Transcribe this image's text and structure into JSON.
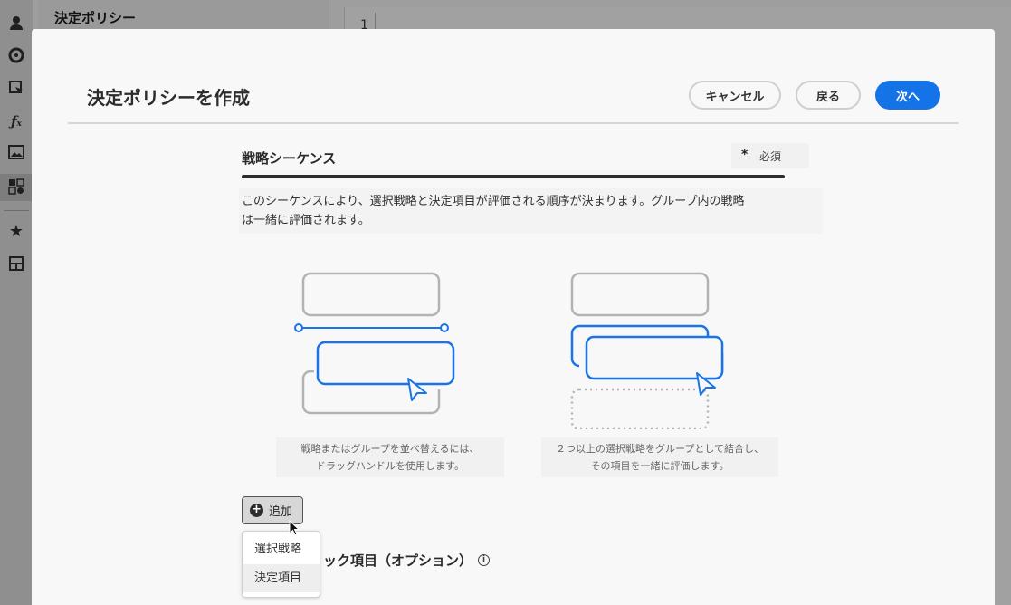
{
  "background": {
    "left_panel_title": "決定ポリシー",
    "editor_line_number": "1",
    "rail_icons": [
      "user-icon",
      "pie-chart-icon",
      "cursor-select-icon",
      "function-icon",
      "image-icon",
      "decision-icon",
      "star-icon",
      "grid-icon"
    ]
  },
  "modal": {
    "title": "決定ポリシーを作成",
    "buttons": {
      "cancel": "キャンセル",
      "back": "戻る",
      "next": "次へ"
    },
    "section": {
      "title": "戦略シーケンス",
      "required_mark": "*",
      "required_label": "必須",
      "description_line1": "このシーケンスにより、選択戦略と決定項目が評価される順序が決まります。グループ内の戦略",
      "description_line2": "は一緒に評価されます。",
      "caption1_line1": "戦略またはグループを並べ替えるには、",
      "caption1_line2": "ドラッグハンドルを使用します。",
      "caption2_line1": "２つ以上の選択戦略をグループとして結合し、",
      "caption2_line2": "その項目を一緒に評価します。"
    },
    "add_button": {
      "label": "追加"
    },
    "add_menu": {
      "items": [
        "選択戦略",
        "決定項目"
      ]
    },
    "fallback_title_partial": "ック項目（オプション）"
  },
  "colors": {
    "accent": "#1473e6",
    "illustration_blue": "#1a73e8",
    "illustration_gray": "#b3b3b3"
  }
}
